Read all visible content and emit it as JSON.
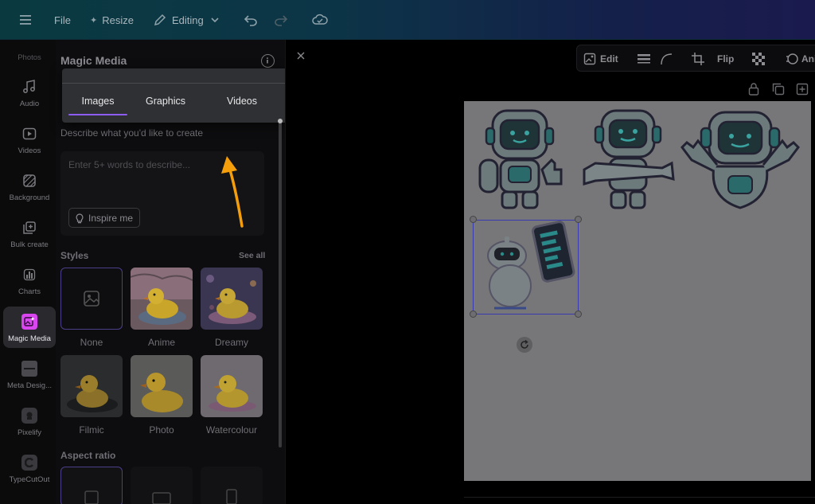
{
  "topbar": {
    "file_label": "File",
    "resize_label": "Resize",
    "editing_label": "Editing"
  },
  "rail": {
    "items": [
      {
        "label": "Photos"
      },
      {
        "label": "Audio"
      },
      {
        "label": "Videos"
      },
      {
        "label": "Background"
      },
      {
        "label": "Bulk create"
      },
      {
        "label": "Charts"
      },
      {
        "label": "Magic Media"
      },
      {
        "label": "Meta Desig..."
      },
      {
        "label": "Pixelify"
      },
      {
        "label": "TypeCutOut"
      }
    ]
  },
  "panel": {
    "title": "Magic Media",
    "tabs": [
      {
        "label": "Images"
      },
      {
        "label": "Graphics"
      },
      {
        "label": "Videos"
      }
    ],
    "prompt_label": "Describe what you'd like to create",
    "prompt_placeholder": "Enter 5+ words to describe...",
    "inspire_label": "Inspire me",
    "styles_label": "Styles",
    "see_all_label": "See all",
    "styles": [
      {
        "label": "None"
      },
      {
        "label": "Anime"
      },
      {
        "label": "Dreamy"
      },
      {
        "label": "Filmic"
      },
      {
        "label": "Photo"
      },
      {
        "label": "Watercolour"
      }
    ],
    "aspect_label": "Aspect ratio"
  },
  "context_toolbar": {
    "edit_label": "Edit",
    "flip_label": "Flip",
    "animate_label": "Ani"
  },
  "colors": {
    "accent": "#8b5cf6",
    "magic_media_icon": "#d946ef",
    "annotation_arrow": "#f59e0b"
  }
}
